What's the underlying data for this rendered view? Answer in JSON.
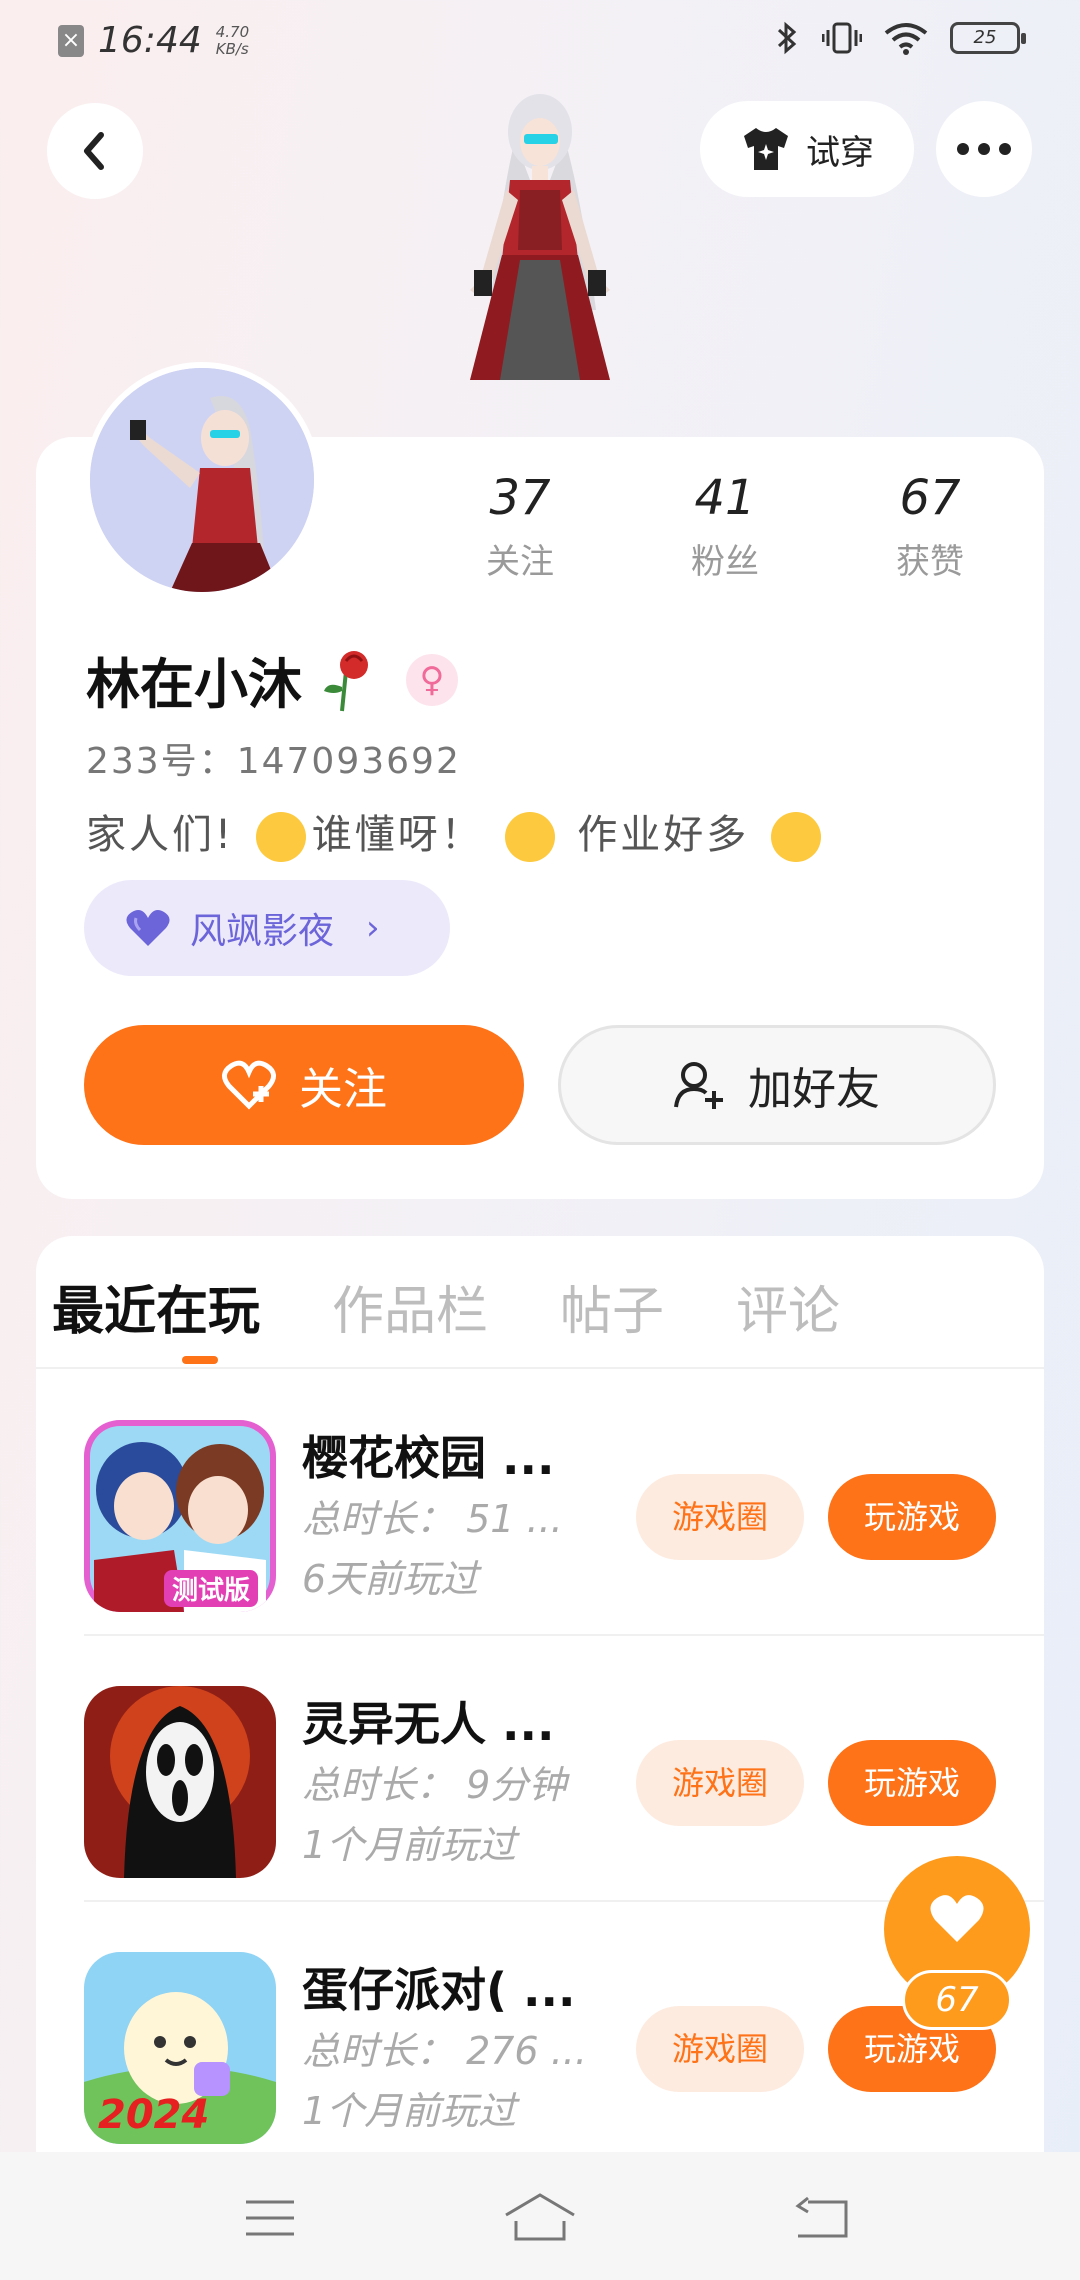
{
  "status_bar": {
    "time": "16:44",
    "net_speed_value": "4.70",
    "net_speed_unit": "KB/s",
    "battery": "25"
  },
  "header": {
    "try_on_label": "试穿"
  },
  "profile": {
    "stats": [
      {
        "value": "37",
        "label": "关注"
      },
      {
        "value": "41",
        "label": "粉丝"
      },
      {
        "value": "67",
        "label": "获赞"
      }
    ],
    "username": "林在小沐",
    "gender": "female",
    "account_id": "233号：147093692",
    "bio_part1": "家人们!",
    "bio_part2": "谁懂呀！",
    "bio_part3": "作业好多",
    "guild_tag": "风飒影夜",
    "follow_label": "关注",
    "add_friend_label": "加好友"
  },
  "tabs": [
    "最近在玩",
    "作品栏",
    "帖子",
    "评论"
  ],
  "games": [
    {
      "title": "樱花校园 ...",
      "duration": "总时长： 51 ...",
      "last_played": "6天前玩过",
      "circle_label": "游戏圈",
      "play_label": "玩游戏",
      "badge": "测试版"
    },
    {
      "title": "灵异无人 ...",
      "duration": "总时长： 9分钟",
      "last_played": "1个月前玩过",
      "circle_label": "游戏圈",
      "play_label": "玩游戏"
    },
    {
      "title": "蛋仔派对( ...",
      "duration": "总时长： 276 ...",
      "last_played": "1个月前玩过",
      "circle_label": "游戏圈",
      "play_label": "玩游戏",
      "badge": "2024"
    }
  ],
  "float_like": {
    "count": "67"
  },
  "colors": {
    "accent": "#fe7218",
    "guild": "#6c64d9",
    "like": "#fe9a1c"
  }
}
